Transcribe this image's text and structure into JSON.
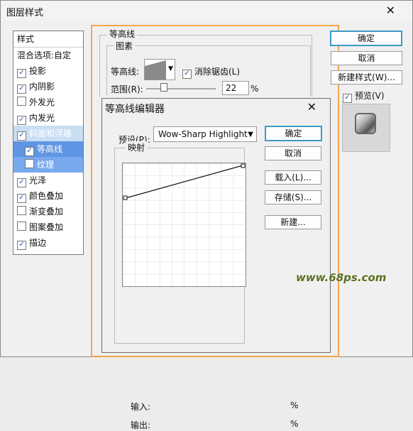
{
  "window": {
    "title": "图层样式",
    "close_label": "✕"
  },
  "left_panel": {
    "header": "样式",
    "items": [
      {
        "label": "混合选项:自定",
        "checked": false,
        "style": "plain"
      },
      {
        "label": "投影",
        "checked": true,
        "style": "checkbox"
      },
      {
        "label": "内阴影",
        "checked": true,
        "style": "checkbox"
      },
      {
        "label": "外发光",
        "checked": false,
        "style": "checkbox"
      },
      {
        "label": "内发光",
        "checked": true,
        "style": "checkbox"
      },
      {
        "label": "斜面和浮雕",
        "checked": true,
        "style": "checkbox-active"
      },
      {
        "label": "等高线",
        "checked": true,
        "style": "sub"
      },
      {
        "label": "纹理",
        "checked": false,
        "style": "sub2"
      },
      {
        "label": "光泽",
        "checked": true,
        "style": "checkbox"
      },
      {
        "label": "颜色叠加",
        "checked": true,
        "style": "checkbox"
      },
      {
        "label": "渐变叠加",
        "checked": false,
        "style": "checkbox"
      },
      {
        "label": "图案叠加",
        "checked": false,
        "style": "checkbox"
      },
      {
        "label": "描边",
        "checked": true,
        "style": "checkbox"
      }
    ]
  },
  "main_panel": {
    "section_title": "等高线",
    "elements_title": "图素",
    "contour_label": "等高线:",
    "anti_alias_label": "消除锯齿(L)",
    "range_label": "范围(R):",
    "range_value": "22",
    "range_unit": "%"
  },
  "right_buttons": {
    "ok": "确定",
    "cancel": "取消",
    "new_style": "新建样式(W)...",
    "preview": "预览(V)"
  },
  "dialog": {
    "title": "等高线编辑器",
    "close_label": "✕",
    "preset_label": "预设(P):",
    "preset_value": "Wow-Sharp Highlight",
    "mapping_label": "映射",
    "input_label": "输入:",
    "output_label": "输出:",
    "percent": "%",
    "buttons": {
      "ok": "确定",
      "cancel": "取消",
      "load": "载入(L)...",
      "save": "存储(S)...",
      "new": "新建..."
    }
  },
  "watermark": "www.68ps.com"
}
